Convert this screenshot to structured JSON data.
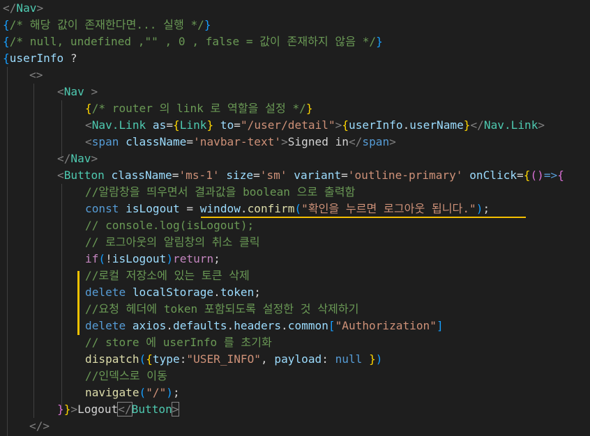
{
  "lines": [
    [
      {
        "t": "</",
        "c": "dim"
      },
      {
        "t": "Nav",
        "c": "tag"
      },
      {
        "t": ">",
        "c": "dim"
      }
    ],
    [
      {
        "t": "{",
        "c": "p3"
      },
      {
        "t": "/* 해당 값이 존재한다면... 실행 */",
        "c": "cm"
      },
      {
        "t": "}",
        "c": "p3"
      }
    ],
    [
      {
        "t": "{",
        "c": "p3"
      },
      {
        "t": "/* null, undefined ,\"\" , 0 , false = 값이 존재하지 않음 */",
        "c": "cm"
      },
      {
        "t": "}",
        "c": "p3"
      }
    ],
    [
      {
        "t": "{",
        "c": "p3"
      },
      {
        "t": "userInfo",
        "c": "var"
      },
      {
        "t": " ?",
        "c": "txt"
      }
    ],
    [
      {
        "t": "<>",
        "c": "dim"
      }
    ],
    [
      {
        "t": "<",
        "c": "dim"
      },
      {
        "t": "Nav",
        "c": "tag"
      },
      {
        "t": " >",
        "c": "dim"
      }
    ],
    [
      {
        "t": "{",
        "c": "p1"
      },
      {
        "t": "/* router 의 link 로 역할을 설정 */",
        "c": "cm"
      },
      {
        "t": "}",
        "c": "p1"
      }
    ],
    [
      {
        "t": "<",
        "c": "dim"
      },
      {
        "t": "Nav.Link",
        "c": "tag"
      },
      {
        "t": " ",
        "c": "txt"
      },
      {
        "t": "as",
        "c": "var"
      },
      {
        "t": "=",
        "c": "txt"
      },
      {
        "t": "{",
        "c": "p1"
      },
      {
        "t": "Link",
        "c": "tag"
      },
      {
        "t": "}",
        "c": "p1"
      },
      {
        "t": " ",
        "c": "txt"
      },
      {
        "t": "to",
        "c": "var"
      },
      {
        "t": "=",
        "c": "txt"
      },
      {
        "t": "\"/user/detail\"",
        "c": "str"
      },
      {
        "t": ">",
        "c": "dim"
      },
      {
        "t": "{",
        "c": "p1"
      },
      {
        "t": "userInfo",
        "c": "var"
      },
      {
        "t": ".",
        "c": "txt"
      },
      {
        "t": "userName",
        "c": "var"
      },
      {
        "t": "}",
        "c": "p1"
      },
      {
        "t": "</",
        "c": "dim"
      },
      {
        "t": "Nav.Link",
        "c": "tag"
      },
      {
        "t": ">",
        "c": "dim"
      }
    ],
    [
      {
        "t": "<",
        "c": "dim"
      },
      {
        "t": "span",
        "c": "kw"
      },
      {
        "t": " ",
        "c": "txt"
      },
      {
        "t": "className",
        "c": "var"
      },
      {
        "t": "=",
        "c": "txt"
      },
      {
        "t": "'navbar-text'",
        "c": "str"
      },
      {
        "t": ">",
        "c": "dim"
      },
      {
        "t": "Signed in",
        "c": "txt"
      },
      {
        "t": "</",
        "c": "dim"
      },
      {
        "t": "span",
        "c": "kw"
      },
      {
        "t": ">",
        "c": "dim"
      }
    ],
    [
      {
        "t": "</",
        "c": "dim"
      },
      {
        "t": "Nav",
        "c": "tag"
      },
      {
        "t": ">",
        "c": "dim"
      }
    ],
    [
      {
        "t": "<",
        "c": "dim"
      },
      {
        "t": "Button",
        "c": "tag"
      },
      {
        "t": " ",
        "c": "txt"
      },
      {
        "t": "className",
        "c": "var"
      },
      {
        "t": "=",
        "c": "txt"
      },
      {
        "t": "'ms-1'",
        "c": "str"
      },
      {
        "t": " ",
        "c": "txt"
      },
      {
        "t": "size",
        "c": "var"
      },
      {
        "t": "=",
        "c": "txt"
      },
      {
        "t": "'sm'",
        "c": "str"
      },
      {
        "t": " ",
        "c": "txt"
      },
      {
        "t": "variant",
        "c": "var"
      },
      {
        "t": "=",
        "c": "txt"
      },
      {
        "t": "'outline-primary'",
        "c": "str"
      },
      {
        "t": " ",
        "c": "txt"
      },
      {
        "t": "onClick",
        "c": "var"
      },
      {
        "t": "=",
        "c": "txt"
      },
      {
        "t": "{",
        "c": "p1"
      },
      {
        "t": "(",
        "c": "p2"
      },
      {
        "t": ")",
        "c": "p2"
      },
      {
        "t": "=>",
        "c": "kw"
      },
      {
        "t": "{",
        "c": "p2"
      }
    ],
    [
      {
        "t": "//알람창을 띄우면서 결과값을 boolean 으로 출력함",
        "c": "cm"
      }
    ],
    [
      {
        "t": "const",
        "c": "kw"
      },
      {
        "t": " ",
        "c": "txt"
      },
      {
        "t": "isLogout",
        "c": "var"
      },
      {
        "t": " = ",
        "c": "txt"
      },
      {
        "t": "window",
        "c": "var"
      },
      {
        "t": ".",
        "c": "txt"
      },
      {
        "t": "confirm",
        "c": "fn"
      },
      {
        "t": "(",
        "c": "p3"
      },
      {
        "t": "\"확인을 누르면 로그아웃 됩니다.\"",
        "c": "str"
      },
      {
        "t": ")",
        "c": "p3"
      },
      {
        "t": ";",
        "c": "txt"
      }
    ],
    [
      {
        "t": "// console.log(isLogout);",
        "c": "cm"
      }
    ],
    [
      {
        "t": "// 로그아웃의 알림창의 취소 클릭",
        "c": "cm"
      }
    ],
    [
      {
        "t": "if",
        "c": "ctl"
      },
      {
        "t": "(",
        "c": "p3"
      },
      {
        "t": "!",
        "c": "txt"
      },
      {
        "t": "isLogout",
        "c": "var"
      },
      {
        "t": ")",
        "c": "p3"
      },
      {
        "t": "return",
        "c": "ctl"
      },
      {
        "t": ";",
        "c": "txt"
      }
    ],
    [
      {
        "t": "//로컬 저장소에 있는 토큰 삭제",
        "c": "cm"
      }
    ],
    [
      {
        "t": "delete",
        "c": "kw"
      },
      {
        "t": " ",
        "c": "txt"
      },
      {
        "t": "localStorage",
        "c": "var"
      },
      {
        "t": ".",
        "c": "txt"
      },
      {
        "t": "token",
        "c": "var"
      },
      {
        "t": ";",
        "c": "txt"
      }
    ],
    [
      {
        "t": "//요청 헤더에 token 포함되도록 설정한 것 삭제하기",
        "c": "cm"
      }
    ],
    [
      {
        "t": "delete",
        "c": "kw"
      },
      {
        "t": " ",
        "c": "txt"
      },
      {
        "t": "axios",
        "c": "var"
      },
      {
        "t": ".",
        "c": "txt"
      },
      {
        "t": "defaults",
        "c": "var"
      },
      {
        "t": ".",
        "c": "txt"
      },
      {
        "t": "headers",
        "c": "var"
      },
      {
        "t": ".",
        "c": "txt"
      },
      {
        "t": "common",
        "c": "var"
      },
      {
        "t": "[",
        "c": "p3"
      },
      {
        "t": "\"Authorization\"",
        "c": "str"
      },
      {
        "t": "]",
        "c": "p3"
      }
    ],
    [
      {
        "t": "// store 에 userInfo 를 초기화",
        "c": "cm"
      }
    ],
    [
      {
        "t": "dispatch",
        "c": "fn"
      },
      {
        "t": "(",
        "c": "p3"
      },
      {
        "t": "{",
        "c": "p1"
      },
      {
        "t": "type",
        "c": "var"
      },
      {
        "t": ":",
        "c": "txt"
      },
      {
        "t": "\"USER_INFO\"",
        "c": "str"
      },
      {
        "t": ", ",
        "c": "txt"
      },
      {
        "t": "payload",
        "c": "var"
      },
      {
        "t": ": ",
        "c": "txt"
      },
      {
        "t": "null",
        "c": "kw"
      },
      {
        "t": " ",
        "c": "txt"
      },
      {
        "t": "}",
        "c": "p1"
      },
      {
        "t": ")",
        "c": "p3"
      }
    ],
    [
      {
        "t": "//인덱스로 이동",
        "c": "cm"
      }
    ],
    [
      {
        "t": "navigate",
        "c": "fn"
      },
      {
        "t": "(",
        "c": "p3"
      },
      {
        "t": "\"/\"",
        "c": "str"
      },
      {
        "t": ")",
        "c": "p3"
      },
      {
        "t": ";",
        "c": "txt"
      }
    ],
    [
      {
        "t": "}",
        "c": "p2"
      },
      {
        "t": "}",
        "c": "p1"
      },
      {
        "t": ">",
        "c": "dim"
      },
      {
        "t": "Logout",
        "c": "txt"
      },
      {
        "t": "</",
        "c": "dim bx"
      },
      {
        "t": "Button",
        "c": "tag"
      },
      {
        "t": ">",
        "c": "dim bx"
      }
    ],
    [
      {
        "t": "</>",
        "c": "dim"
      }
    ]
  ]
}
